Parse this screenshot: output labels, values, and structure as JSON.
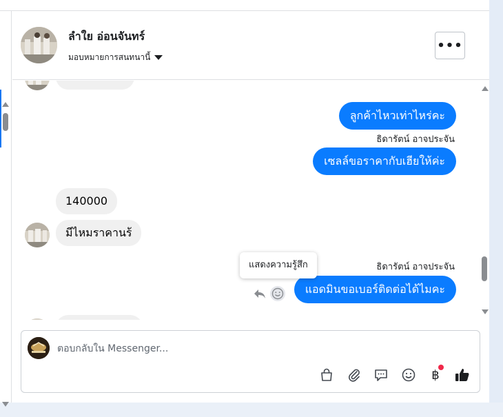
{
  "header": {
    "contact_name": "ลำใย อ่อนจันทร์",
    "assignment_label": "มอบหมายการสนทนานี้",
    "more_label": "•••"
  },
  "thread": {
    "messages": [
      {
        "direction": "in",
        "text": ""
      },
      {
        "direction": "out",
        "text": "ลูกค้าไหวเท่าไหร่คะ"
      },
      {
        "direction": "out",
        "sender": "ธิดารัตน์ อาจประจัน",
        "text": "เซลล์ขอราคากับเฮียให้ค่ะ"
      },
      {
        "direction": "in",
        "text": "140000"
      },
      {
        "direction": "in",
        "text": "มีไหมราคานร้"
      },
      {
        "direction": "out",
        "sender": "ธิดารัตน์ อาจประจัน",
        "text": "แอดมินขอเบอร์ติดต่อได้ไมคะ"
      }
    ],
    "tooltip": "แสดงความรู้สึก"
  },
  "composer": {
    "placeholder": "ตอบกลับใน Messenger...",
    "value": "",
    "tools": [
      "shopping-bag-icon",
      "attachment-icon",
      "saved-replies-icon",
      "emoji-icon",
      "baht-payment-icon",
      "like-icon"
    ],
    "baht_symbol": "฿"
  },
  "colors": {
    "outgoing_bubble": "#0a7cff",
    "incoming_bubble": "#f0f0f0",
    "notification_dot": "#f02849"
  }
}
